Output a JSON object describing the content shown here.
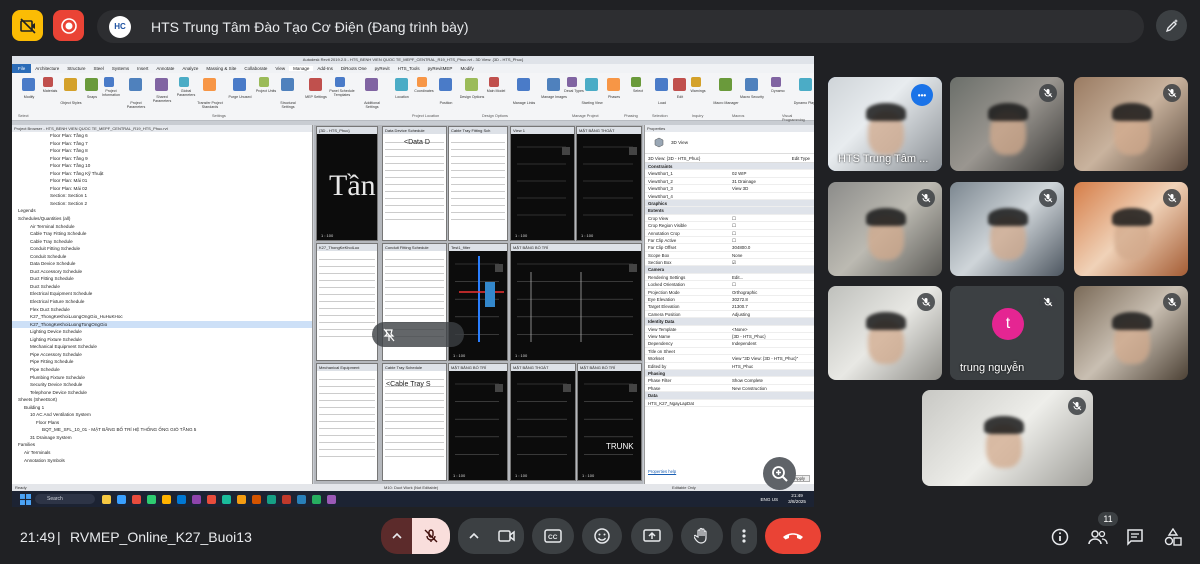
{
  "topbar": {
    "presentation_title": "HTS Trung Tâm Đào Tạo Cơ Điện (Đang trình bày)",
    "logo_text": "HC"
  },
  "revit": {
    "window_title": "Autodesk Revit 2019.2.5 - HTS_BENH VIEN QUOC TE_MEPF_CENTRAL_R19_HTS_Phuc.rvt - 3D View: {3D - HTS_Phuc}",
    "menu": [
      "File",
      "Architecture",
      "Structure",
      "Steel",
      "Systems",
      "Insert",
      "Annotate",
      "Analyze",
      "Massing & Site",
      "Collaborate",
      "View",
      "Manage",
      "Add-Ins",
      "DiRoots One",
      "pyRevit",
      "HTS_Tools",
      "pyRevitMEP",
      "Modify"
    ],
    "ribbon_buttons": [
      "Modify",
      "Materials",
      "Object Styles",
      "Snaps",
      "Project Information",
      "Project Parameters",
      "Shared Parameters",
      "Global Parameters",
      "Transfer Project Standards",
      "Purge Unused",
      "Project Units",
      "Structural Settings",
      "MEP Settings",
      "Panel Schedule Templates",
      "Additional Settings",
      "Location",
      "Coordinates",
      "Position",
      "Design Options",
      "Main Model",
      "Manage Links",
      "Manage Images",
      "Decal Types",
      "Starting View",
      "Phases",
      "Select",
      "Load",
      "Edit",
      "Warnings",
      "Macro Manager",
      "Macro Security",
      "Dynamo",
      "Dynamo Player"
    ],
    "ribbon_groups": [
      "Select",
      "Settings",
      "Project Location",
      "Design Options",
      "Manage Project",
      "Phasing",
      "Selection",
      "Inquiry",
      "Macros",
      "Visual Programming"
    ],
    "browser_header": "Project Browser - HTS_BENH VIEN QUOC TE_MEPF_CENTRAL_R19_HTS_Phuc.rvt",
    "browser_items": [
      "Floor Plan: Tầng 6",
      "Floor Plan: Tầng 7",
      "Floor Plan: Tầng 8",
      "Floor Plan: Tầng 9",
      "Floor Plan: Tầng 10",
      "Floor Plan: Tầng Kỹ Thuật",
      "Floor Plan: Mái 01",
      "Floor Plan: Mái 02",
      "Section: Section 1",
      "Section: Section 2",
      "Legends",
      "Schedules/Quantities (all)",
      "Air Terminal Schedule",
      "Cable Tray Fitting Schedule",
      "Cable Tray Schedule",
      "Conduit Fitting Schedule",
      "Conduit Schedule",
      "Data Device Schedule",
      "Duct Accessory Schedule",
      "Duct Fitting Schedule",
      "Duct Schedule",
      "Electrical Equipment Schedule",
      "Electrical Fixture Schedule",
      "Flex Duct Schedule",
      "K27_ThongKeKhoiLuongOngGio_HuHuKHoc",
      "K27_ThongKeKhoiLuongTongOngGio",
      "Lighting Device Schedule",
      "Lighting Fixture Schedule",
      "Mechanical Equipment Schedule",
      "Pipe Accessory Schedule",
      "Pipe Fitting Schedule",
      "Pipe Schedule",
      "Plumbing Fixture Schedule",
      "Security Device Schedule",
      "Telephone Device Schedule",
      "Sheets (SheetSort)",
      "Building 1",
      "10 AC And Ventilation System",
      "Floor Plans",
      "BQT_ME_SFL_10_01 - MẶT BẰNG BỐ TRÍ HỆ THỐNG ỐNG GIÓ TẦNG 5",
      "31 Drainage System",
      "Families",
      "Air Terminals",
      "Annotation Symbols"
    ],
    "view_tabs": [
      "{3D - HTS_Phuc}",
      "Data Device Schedule",
      "Cable Tray Fitting Sch",
      "View 1",
      "MẶT BẰNG THOÁT",
      "K27_ThongKeKhoiLuo",
      "Conduit Fitting Schedule",
      "Test1_filter",
      "MẶT BẰNG BỐ TRÍ",
      "Mechanical Equipment",
      "Cable Tray Schedule",
      "MẶT BẰNG BỐ TRÍ",
      "MẶT BẰNG THOÁT",
      "MẶT BẰNG BỐ TRÍ",
      "BQT_ME_SFL_10_01"
    ],
    "view_scale": "1 : 100",
    "view_text_data": "<Data D",
    "view_text_cable": "<Cable Tray S",
    "view_text_trunking": "TRUNK",
    "properties": {
      "header": "Properties",
      "type": "3D View",
      "instance": "3D View: {3D - HTS_Phuc}",
      "edit_type": "Edit Type",
      "rows": [
        {
          "k": "Constraints",
          "v": "",
          "sec": true
        },
        {
          "k": "ViewShort_1",
          "v": "02 WIP"
        },
        {
          "k": "ViewShort_2",
          "v": "31 Drainage"
        },
        {
          "k": "ViewShort_3",
          "v": "View 3D"
        },
        {
          "k": "ViewShort_4",
          "v": ""
        },
        {
          "k": "Graphics",
          "v": "",
          "sec": true
        },
        {
          "k": "Extents",
          "v": "",
          "sec": true
        },
        {
          "k": "Crop View",
          "v": "☐"
        },
        {
          "k": "Crop Region Visible",
          "v": "☐"
        },
        {
          "k": "Annotation Crop",
          "v": "☐"
        },
        {
          "k": "Far Clip Active",
          "v": "☐"
        },
        {
          "k": "Far Clip Offset",
          "v": "304800.0"
        },
        {
          "k": "Scope Box",
          "v": "None"
        },
        {
          "k": "Section Box",
          "v": "☑"
        },
        {
          "k": "Camera",
          "v": "",
          "sec": true
        },
        {
          "k": "Rendering Settings",
          "v": "Edit..."
        },
        {
          "k": "Locked Orientation",
          "v": "☐"
        },
        {
          "k": "Projection Mode",
          "v": "Orthographic"
        },
        {
          "k": "Eye Elevation",
          "v": "30272.8"
        },
        {
          "k": "Target Elevation",
          "v": "21300.7"
        },
        {
          "k": "Camera Position",
          "v": "Adjusting"
        },
        {
          "k": "Identity Data",
          "v": "",
          "sec": true
        },
        {
          "k": "View Template",
          "v": "<None>"
        },
        {
          "k": "View Name",
          "v": "{3D - HTS_Phuc}"
        },
        {
          "k": "Dependency",
          "v": "Independent"
        },
        {
          "k": "Title on Sheet",
          "v": ""
        },
        {
          "k": "Workset",
          "v": "View \"3D View: {3D - HTS_Phuc}\""
        },
        {
          "k": "Edited by",
          "v": "HTS_Phuc"
        },
        {
          "k": "Phasing",
          "v": "",
          "sec": true
        },
        {
          "k": "Phase Filter",
          "v": "Show Complete"
        },
        {
          "k": "Phase",
          "v": "New Construction"
        },
        {
          "k": "Data",
          "v": "",
          "sec": true
        },
        {
          "k": "HTS_K27_NgayLapDat",
          "v": ""
        }
      ],
      "help_link": "Properties help",
      "apply": "Apply"
    },
    "status_left": "Ready",
    "status_mid": "M10: Duct Work (Not Editable)",
    "status_right": "Editable Only",
    "taskbar_search": "Search",
    "tray_lang": "ENG US",
    "tray_time": "21:49",
    "tray_date": "3/8/2025"
  },
  "participants": [
    {
      "name": "HTS Trung Tâm ...",
      "muted": false,
      "active": true
    },
    {
      "name": "",
      "muted": true
    },
    {
      "name": "",
      "muted": true
    },
    {
      "name": "",
      "muted": true
    },
    {
      "name": "",
      "muted": true
    },
    {
      "name": "",
      "muted": true
    },
    {
      "name": "",
      "muted": true
    },
    {
      "name": "trung nguyễn",
      "muted": true,
      "avatar_letter": "t"
    },
    {
      "name": "",
      "muted": true
    },
    {
      "name": "",
      "muted": true
    }
  ],
  "bottombar": {
    "time": "21:49",
    "separator": "|",
    "meeting_code": "RVMEP_Online_K27_Buoi13",
    "people_count": "11"
  },
  "colors": {
    "background": "#202124",
    "accent": "#8ab4f8",
    "end_call": "#ea4335",
    "mic_off_bg": "#f9dedc",
    "record_red": "#ea4335",
    "caption_yellow": "#fbbc04"
  }
}
